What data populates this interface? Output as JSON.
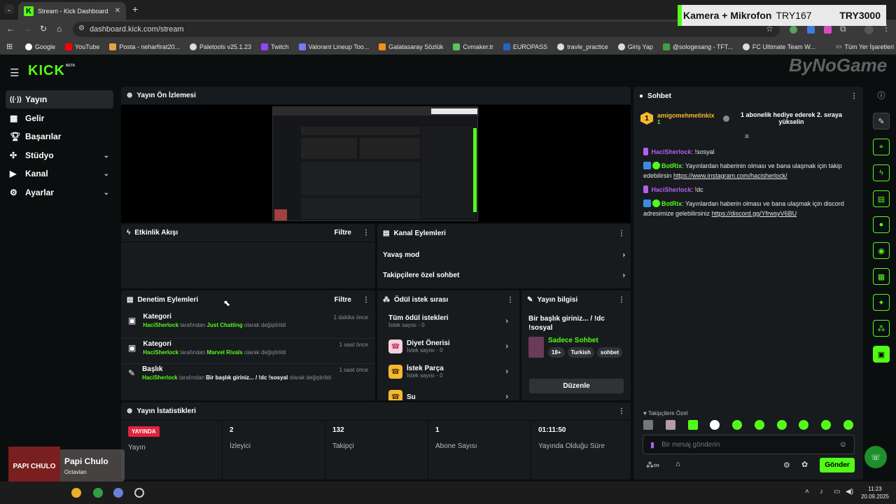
{
  "browser": {
    "tab_title": "Stream - Kick Dashboard",
    "url": "dashboard.kick.com/stream",
    "bookmarks": [
      "Google",
      "YouTube",
      "Posta - neharfirat20...",
      "Paletools v25.1.23",
      "Twitch",
      "Valorant Lineup Too...",
      "Galatasaray Sözlük",
      "Cvmaker.tr",
      "EUROPASS",
      "travle_practice",
      "Giriş Yap",
      "@sologesang - TFT...",
      "FC Ultimate Team W..."
    ],
    "all_bookmarks": "Tüm Yer İşaretleri"
  },
  "overlay": {
    "label": "Kamera + Mikrofon",
    "amount1": "TRY167",
    "amount2": "TRY3000"
  },
  "watermark": "ByNoGame",
  "logo": "KICK",
  "logo_badge": "BETA",
  "sidebar": {
    "items": [
      {
        "label": "Yayın",
        "icon": "broadcast-icon"
      },
      {
        "label": "Gelir",
        "icon": "revenue-icon"
      },
      {
        "label": "Başarılar",
        "icon": "trophy-icon"
      },
      {
        "label": "Stüdyo",
        "icon": "studio-icon"
      },
      {
        "label": "Kanal",
        "icon": "channel-icon"
      },
      {
        "label": "Ayarlar",
        "icon": "gear-icon"
      }
    ]
  },
  "preview": {
    "title": "Yayın Ön İzlemesi"
  },
  "activity": {
    "title": "Etkinlik Akışı",
    "filter": "Filtre"
  },
  "channel_actions": {
    "title": "Kanal Eylemleri",
    "items": [
      "Yavaş mod",
      "Takipçilere özel sohbet"
    ]
  },
  "moderation": {
    "title": "Denetim Eylemleri",
    "filter": "Filtre",
    "items": [
      {
        "title": "Kategori",
        "time": "1 dakika önce",
        "user": "HaciSherlock",
        "mid": "tarafından",
        "value": "Just Chatting",
        "suffix": "olarak değiştirildi"
      },
      {
        "title": "Kategori",
        "time": "1 saat önce",
        "user": "HaciSherlock",
        "mid": "tarafından",
        "value": "Marvel Rivals",
        "suffix": "olarak değiştirildi"
      },
      {
        "title": "Başlık",
        "time": "1 saat önce",
        "user": "HaciSherlock",
        "mid": "tarafından",
        "value": "Bir başlık giriniz... / !dc !sosyal",
        "suffix": "olarak değiştirildi"
      }
    ]
  },
  "rewards": {
    "title": "Ödül istek sırası",
    "items": [
      {
        "name": "Tüm ödül istekleri",
        "count": "İstek sayısı - 0"
      },
      {
        "name": "Diyet Önerisi",
        "count": "İstek sayısı - 0"
      },
      {
        "name": "İstek Parça",
        "count": "İstek sayısı - 0"
      },
      {
        "name": "Su",
        "count": ""
      }
    ]
  },
  "stream_info": {
    "title": "Yayın bilgisi",
    "stream_title": "Bir başlık giriniz... / !dc !sosyal",
    "category": "Sadece Sohbet",
    "tags": [
      "18+",
      "Turkish",
      "sohbet"
    ],
    "edit": "Düzenle"
  },
  "stats": {
    "title": "Yayın İstatistikleri",
    "live_badge": "YAYINDA",
    "items": [
      {
        "value": "",
        "label": "Yayın"
      },
      {
        "value": "2",
        "label": "İzleyici"
      },
      {
        "value": "132",
        "label": "Takipçi"
      },
      {
        "value": "1",
        "label": "Abone Sayısı"
      },
      {
        "value": "01:11:50",
        "label": "Yayında Olduğu Süre"
      }
    ]
  },
  "chat": {
    "title": "Sohbet",
    "pinned_user": "amigomehmetinkix",
    "pinned_count": "1",
    "pinned_text": "1 abonelik hediye ederek 2. sıraya yükselin",
    "messages": [
      {
        "user": "HaciSherlock",
        "text": "!sosyal",
        "link": ""
      },
      {
        "user": "BotRix",
        "text": "Yayınlardan haberinin olması ve bana ulaşmak için takip edebilirsin",
        "link": "https://www.instagram.com/hacisherlock/"
      },
      {
        "user": "HaciSherlock",
        "text": "!dc",
        "link": ""
      },
      {
        "user": "BotRix",
        "text": "Yayınlardan haberin olması ve bana ulaşmak için discord adresimize gelebilirsiniz",
        "link": "https://discord.gg/YfrwsyV6BU"
      }
    ],
    "followers_only": "Takipçilere Özel",
    "placeholder": "Bir mesaj gönderin",
    "send": "Gönder"
  },
  "music": {
    "title": "Papi Chulo",
    "artist": "Octavian",
    "art_text": "PAPI CHULO"
  },
  "clock": {
    "time": "11:23",
    "date": "20.09.2025"
  },
  "colors": {
    "accent": "#53fc18",
    "live": "#e0243f"
  }
}
